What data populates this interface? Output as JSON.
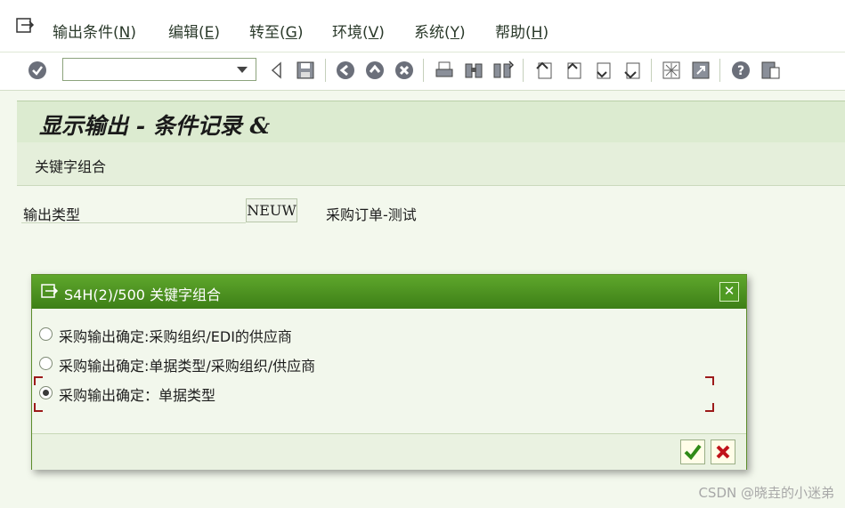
{
  "menubar": {
    "items": [
      {
        "text": "输出条件(",
        "key": "N",
        "end": ")"
      },
      {
        "text": "编辑(",
        "key": "E",
        "end": ")"
      },
      {
        "text": "转至(",
        "key": "G",
        "end": ")"
      },
      {
        "text": "环境(",
        "key": "V",
        "end": ")"
      },
      {
        "text": "系统(",
        "key": "Y",
        "end": ")"
      },
      {
        "text": "帮助(",
        "key": "H",
        "end": ")"
      }
    ]
  },
  "toolbar": {
    "command_value": "",
    "icons": [
      "enter-icon",
      "back-triangle-icon",
      "save-icon",
      "back-icon",
      "exit-icon",
      "cancel-icon",
      "print-icon",
      "find-icon",
      "find-next-icon",
      "first-page-icon",
      "previous-page-icon",
      "next-page-icon",
      "last-page-icon",
      "create-session-icon",
      "shortcut-icon",
      "help-icon",
      "layout-menu-icon"
    ]
  },
  "page": {
    "title": "显示输出 - 条件记录 &",
    "subtitle": "关键字组合",
    "field_label": "输出类型",
    "field_value": "NEUW",
    "field_desc": "采购订单-测试"
  },
  "dialog": {
    "title": "S4H(2)/500 关键字组合",
    "options": [
      {
        "label": "采购输出确定:采购组织/EDI的供应商",
        "selected": false
      },
      {
        "label": "采购输出确定:单据类型/采购组织/供应商",
        "selected": false
      },
      {
        "label": "采购输出确定：单据类型",
        "selected": true
      }
    ],
    "close_symbol": "✕",
    "confirm_icon": "checkmark-icon",
    "cancel_icon": "cancel-x-icon"
  },
  "watermark": "CSDN @晓垚的小迷弟",
  "colors": {
    "accent": "#4a8f1f",
    "background": "#f3f8ed",
    "cancel_red": "#c0131a"
  }
}
